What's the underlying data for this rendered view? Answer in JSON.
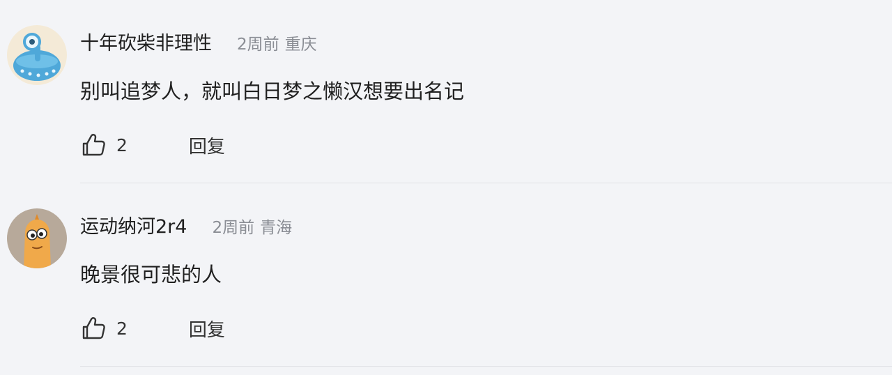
{
  "comments": [
    {
      "username": "十年砍柴非理性",
      "time": "2周前",
      "location": "重庆",
      "text": "别叫追梦人，就叫白日梦之懒汉想要出名记",
      "likes": "2",
      "reply_label": "回复",
      "avatar_icon": "alien-avatar-icon"
    },
    {
      "username": "运动纳河2r4",
      "time": "2周前",
      "location": "青海",
      "text": "晚景很可悲的人",
      "likes": "2",
      "reply_label": "回复",
      "avatar_icon": "cartoon-avatar-icon"
    }
  ],
  "colors": {
    "background": "#f3f4f7",
    "text_primary": "#1f1f1f",
    "text_secondary": "#8a8d94",
    "divider": "#e0e2e6"
  }
}
